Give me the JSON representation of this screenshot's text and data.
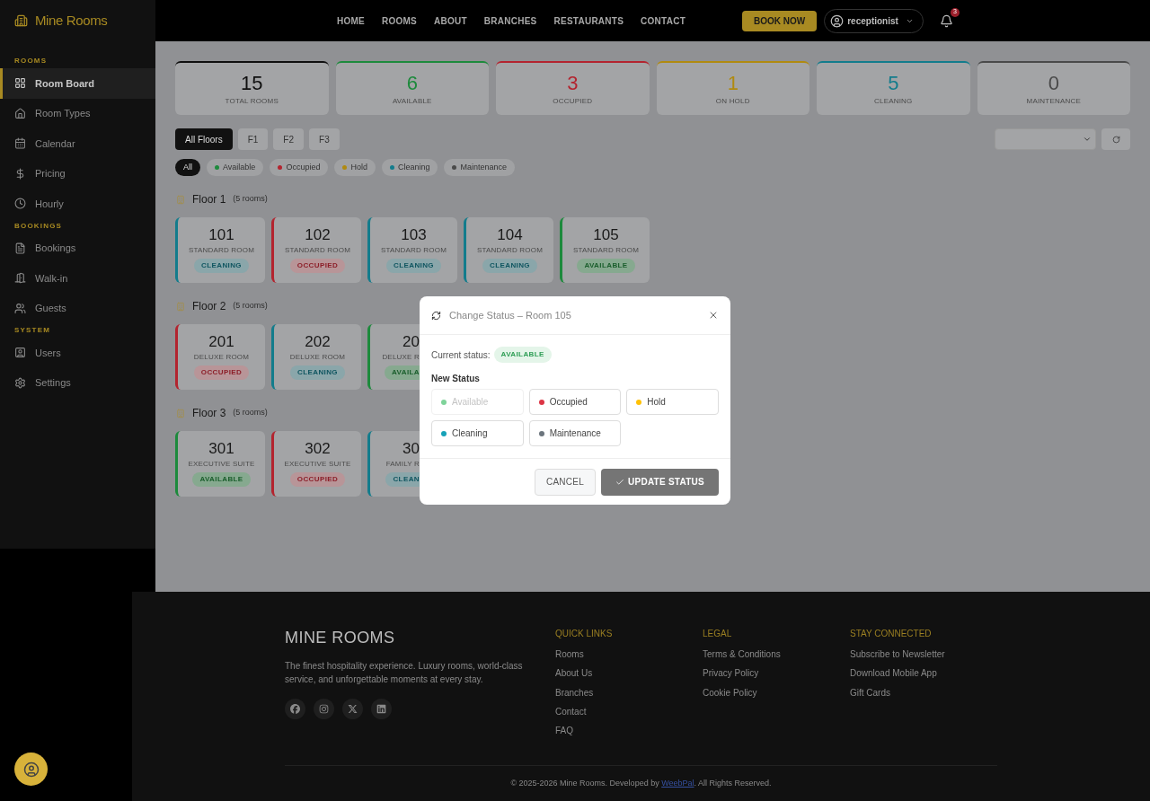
{
  "brand": "Mine Rooms",
  "nav": [
    "HOME",
    "ROOMS",
    "ABOUT",
    "BRANCHES",
    "RESTAURANTS",
    "CONTACT"
  ],
  "book_button": "BOOK NOW",
  "user": "receptionist",
  "notifications": "3",
  "sidebar": [
    {
      "section": "ROOMS",
      "items": [
        {
          "label": "Room Board",
          "selected": true
        },
        {
          "label": "Room Types",
          "selected": false
        },
        {
          "label": "Calendar",
          "selected": false
        },
        {
          "label": "Pricing",
          "selected": false
        },
        {
          "label": "Hourly",
          "selected": false
        }
      ]
    },
    {
      "section": "BOOKINGS",
      "items": [
        {
          "label": "Bookings",
          "selected": false
        },
        {
          "label": "Walk-in",
          "selected": false
        },
        {
          "label": "Guests",
          "selected": false
        }
      ]
    },
    {
      "section": "SYSTEM",
      "items": [
        {
          "label": "Users",
          "selected": false
        },
        {
          "label": "Settings",
          "selected": false
        }
      ]
    }
  ],
  "stats": [
    {
      "value": "15",
      "label": "TOTAL ROOMS",
      "color": "#0f0f0f"
    },
    {
      "value": "6",
      "label": "AVAILABLE",
      "color": "#1d8a3c"
    },
    {
      "value": "3",
      "label": "OCCUPIED",
      "color": "#b3242f"
    },
    {
      "value": "1",
      "label": "ON HOLD",
      "color": "#b08a10"
    },
    {
      "value": "5",
      "label": "CLEANING",
      "color": "#137c8c"
    },
    {
      "value": "0",
      "label": "MAINTENANCE",
      "color": "#4a4a4a"
    }
  ],
  "floor_tabs": [
    {
      "label": "All Floors",
      "selected": true
    },
    {
      "label": "F1",
      "selected": false
    },
    {
      "label": "F2",
      "selected": false
    },
    {
      "label": "F3",
      "selected": false
    }
  ],
  "status_filters": [
    {
      "label": "All",
      "selected": true
    },
    {
      "label": "Available",
      "selected": false,
      "color": "#1d8a3c"
    },
    {
      "label": "Occupied",
      "selected": false,
      "color": "#b3242f"
    },
    {
      "label": "Hold",
      "selected": false,
      "color": "#b08a10"
    },
    {
      "label": "Cleaning",
      "selected": false,
      "color": "#137c8c"
    },
    {
      "label": "Maintenance",
      "selected": false,
      "color": "#4a4a4a"
    }
  ],
  "floors": [
    {
      "title": "Floor 1",
      "count": "(5 rooms)",
      "rooms": [
        {
          "number": "101",
          "type": "STANDARD ROOM",
          "kind": "cleaning",
          "badge": "CLEANING"
        },
        {
          "number": "102",
          "type": "STANDARD ROOM",
          "kind": "occupied",
          "badge": "OCCUPIED"
        },
        {
          "number": "103",
          "type": "STANDARD ROOM",
          "kind": "cleaning",
          "badge": "CLEANING"
        },
        {
          "number": "104",
          "type": "STANDARD ROOM",
          "kind": "cleaning",
          "badge": "CLEANING"
        },
        {
          "number": "105",
          "type": "STANDARD ROOM",
          "kind": "available",
          "badge": "AVAILABLE"
        }
      ]
    },
    {
      "title": "Floor 2",
      "count": "(5 rooms)",
      "rooms": [
        {
          "number": "201",
          "type": "DELUXE ROOM",
          "kind": "occupied",
          "badge": "OCCUPIED"
        },
        {
          "number": "202",
          "type": "DELUXE ROOM",
          "kind": "cleaning",
          "badge": "CLEANING"
        },
        {
          "number": "20",
          "type": "DELUXE R",
          "kind": "available",
          "badge": "AVAILA",
          "cut": true
        }
      ]
    },
    {
      "title": "Floor 3",
      "count": "(5 rooms)",
      "rooms": [
        {
          "number": "301",
          "type": "EXECUTIVE SUITE",
          "kind": "available",
          "badge": "AVAILABLE"
        },
        {
          "number": "302",
          "type": "EXECUTIVE SUITE",
          "kind": "occupied",
          "badge": "OCCUPIED"
        },
        {
          "number": "30",
          "type": "FAMILY R",
          "kind": "cleaning",
          "badge": "CLEAN",
          "cut": true
        }
      ]
    }
  ],
  "modal": {
    "title": "Change Status – Room 105",
    "current_label": "Current status:",
    "current_badge": "AVAILABLE",
    "new_label": "New Status",
    "options": [
      {
        "label": "Available",
        "disabled": true,
        "color": "#7fd39a"
      },
      {
        "label": "Occupied",
        "disabled": false,
        "color": "#dc3545"
      },
      {
        "label": "Hold",
        "disabled": false,
        "color": "#ffc107"
      },
      {
        "label": "Cleaning",
        "disabled": false,
        "color": "#17a2b8"
      },
      {
        "label": "Maintenance",
        "disabled": false,
        "color": "#6c757d"
      }
    ],
    "cancel": "CANCEL",
    "submit": "UPDATE STATUS"
  },
  "footer": {
    "brand": "MINE ROOMS",
    "tagline": "The finest hospitality experience. Luxury rooms, world-class service, and unforgettable moments at every stay.",
    "columns": [
      {
        "title": "QUICK LINKS",
        "links": [
          "Rooms",
          "About Us",
          "Branches",
          "Contact",
          "FAQ"
        ]
      },
      {
        "title": "LEGAL",
        "links": [
          "Terms & Conditions",
          "Privacy Policy",
          "Cookie Policy"
        ]
      },
      {
        "title": "STAY CONNECTED",
        "links": [
          "Subscribe to Newsletter",
          "Download Mobile App",
          "Gift Cards"
        ]
      }
    ],
    "copyright_before": "© 2025-2026 Mine Rooms. Developed by",
    "developer": "WeebPal",
    "copyright_after": ". All Rights Reserved."
  }
}
